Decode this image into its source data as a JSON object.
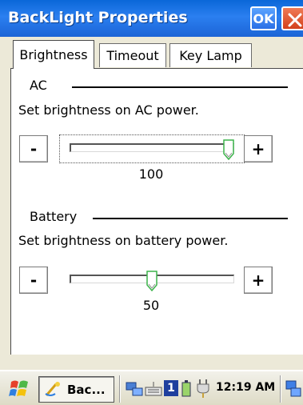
{
  "window": {
    "title": "BackLight Properties",
    "ok_label": "OK"
  },
  "tabs": [
    {
      "label": "Brightness",
      "active": true
    },
    {
      "label": "Timeout",
      "active": false
    },
    {
      "label": "Key Lamp",
      "active": false
    }
  ],
  "ac": {
    "group_label": "AC",
    "description": "Set brightness on AC power.",
    "minus_label": "-",
    "plus_label": "+",
    "value": "100",
    "level_percent": 100
  },
  "battery": {
    "group_label": "Battery",
    "description": "Set brightness on battery power.",
    "minus_label": "-",
    "plus_label": "+",
    "value": "50",
    "level_percent": 50
  },
  "taskbar": {
    "app_label": "Bac...",
    "clock": "12:19 AM",
    "tray_badge": "1"
  },
  "colors": {
    "titlebar": "#1c64d6",
    "thumb_accent": "#3bb34a"
  }
}
